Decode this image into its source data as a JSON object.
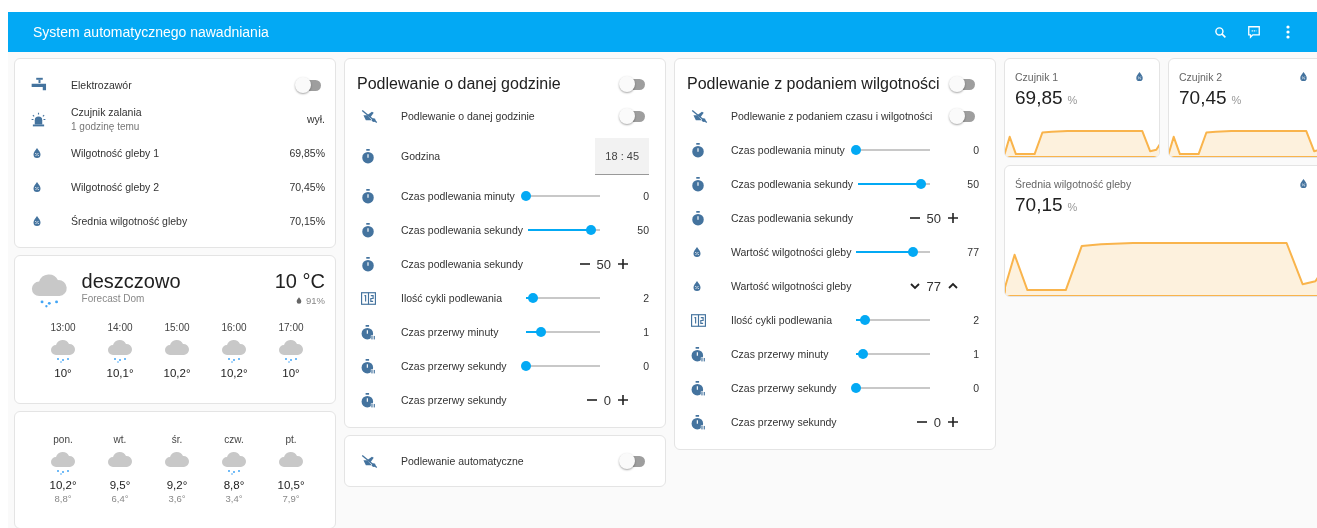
{
  "header": {
    "title": "System automatycznego nawadniania"
  },
  "status_card": {
    "rows": [
      {
        "kind": "toggle",
        "name": "Elektrozawór",
        "on": false
      },
      {
        "kind": "state",
        "name": "Czujnik zalania",
        "secondary": "1 godzinę temu",
        "value": "wył."
      },
      {
        "kind": "state",
        "name": "Wilgotność gleby 1",
        "value": "69,85%"
      },
      {
        "kind": "state",
        "name": "Wilgotność gleby 2",
        "value": "70,45%"
      },
      {
        "kind": "state",
        "name": "Średnia wilgotność gleby",
        "value": "70,15%"
      }
    ]
  },
  "weather": {
    "condition": "deszczowo",
    "source": "Forecast Dom",
    "temperature": "10 °C",
    "humidity": "91%",
    "hourly": [
      {
        "time": "13:00",
        "kind": "rainy",
        "temp": "10°"
      },
      {
        "time": "14:00",
        "kind": "rainy",
        "temp": "10,1°"
      },
      {
        "time": "15:00",
        "kind": "cloudy",
        "temp": "10,2°"
      },
      {
        "time": "16:00",
        "kind": "rainy",
        "temp": "10,2°"
      },
      {
        "time": "17:00",
        "kind": "rainy",
        "temp": "10°"
      }
    ],
    "daily": [
      {
        "day": "pon.",
        "kind": "rainy",
        "high": "10,2°",
        "low": "8,8°"
      },
      {
        "day": "wt.",
        "kind": "cloudy",
        "high": "9,5°",
        "low": "6,4°"
      },
      {
        "day": "śr.",
        "kind": "cloudy",
        "high": "9,2°",
        "low": "3,6°"
      },
      {
        "day": "czw.",
        "kind": "rainy",
        "high": "8,8°",
        "low": "3,4°"
      },
      {
        "day": "pt.",
        "kind": "cloudy",
        "high": "10,5°",
        "low": "7,9°"
      }
    ]
  },
  "schedule_card": {
    "title": "Podlewanie o danej godzinie",
    "on": false,
    "rows": [
      {
        "kind": "toggle",
        "name": "Podlewanie o danej godzinie",
        "on": false
      },
      {
        "kind": "time",
        "name": "Godzina",
        "value": "18 : 45"
      },
      {
        "kind": "slider",
        "name": "Czas podlewania minuty",
        "level": 0,
        "value": "0"
      },
      {
        "kind": "slider",
        "name": "Czas podlewania sekundy",
        "level": 0.85,
        "value": "50"
      },
      {
        "kind": "stepper",
        "name": "Czas podlewania sekundy",
        "value": "50"
      },
      {
        "kind": "slider",
        "name": "Ilość cykli podlewania",
        "level": 0.1,
        "value": "2"
      },
      {
        "kind": "slider",
        "name": "Czas przerwy minuty",
        "level": 0.2,
        "value": "1"
      },
      {
        "kind": "slider",
        "name": "Czas przerwy sekundy",
        "level": 0,
        "value": "0"
      },
      {
        "kind": "stepper",
        "name": "Czas przerwy sekundy",
        "value": "0"
      }
    ]
  },
  "auto_card": {
    "rows": [
      {
        "kind": "toggle",
        "name": "Podlewanie automatyczne",
        "on": false
      }
    ]
  },
  "moisture_card": {
    "title": "Podlewanie z podaniem wilgotności",
    "on": false,
    "rows": [
      {
        "kind": "toggle",
        "name": "Podlewanie z podaniem czasu i wilgotności",
        "on": false
      },
      {
        "kind": "slider",
        "name": "Czas podlewania minuty",
        "level": 0,
        "value": "0"
      },
      {
        "kind": "slider",
        "name": "Czas podlewania sekundy",
        "level": 0.85,
        "value": "50"
      },
      {
        "kind": "stepper",
        "name": "Czas podlewania sekundy",
        "value": "50"
      },
      {
        "kind": "slider",
        "name": "Wartość wilgotności gleby",
        "level": 0.77,
        "value": "77"
      },
      {
        "kind": "spinner",
        "name": "Wartość wilgotności gleby",
        "value": "77"
      },
      {
        "kind": "slider",
        "name": "Ilość cykli podlewania",
        "level": 0.12,
        "value": "2"
      },
      {
        "kind": "slider",
        "name": "Czas przerwy minuty",
        "level": 0.1,
        "value": "1"
      },
      {
        "kind": "slider",
        "name": "Czas przerwy sekundy",
        "level": 0,
        "value": "0"
      },
      {
        "kind": "stepper",
        "name": "Czas przerwy sekundy",
        "value": "0"
      }
    ]
  },
  "sensor_cards": [
    {
      "name": "Czujnik 1",
      "value": "69,85",
      "unit": "%"
    },
    {
      "name": "Czujnik 2",
      "value": "70,45",
      "unit": "%"
    },
    {
      "name": "Średnia wilgotność gleby",
      "value": "70,15",
      "unit": "%"
    }
  ]
}
